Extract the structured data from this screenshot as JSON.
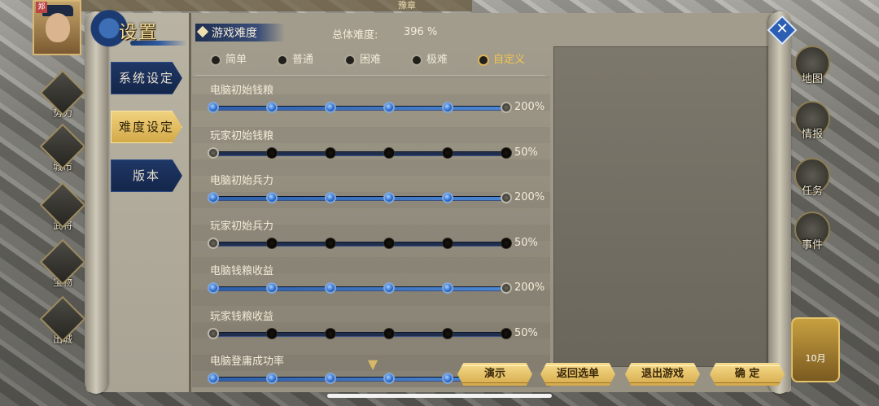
{
  "background": {
    "top_label": "豫章",
    "portrait_tag": "郑",
    "left_menu": [
      {
        "label": "势力"
      },
      {
        "label": "城市"
      },
      {
        "label": "武将"
      },
      {
        "label": "宝物"
      },
      {
        "label": "出城"
      }
    ],
    "right_menu": [
      {
        "label": "地图"
      },
      {
        "label": "情报"
      },
      {
        "label": "任务"
      },
      {
        "label": "事件"
      }
    ],
    "month": "10月"
  },
  "panel": {
    "title": "设置",
    "close_glyph": "✕",
    "tabs": [
      {
        "label": "系统设定",
        "active": false
      },
      {
        "label": "难度设定",
        "active": true
      },
      {
        "label": "版本",
        "active": false
      }
    ]
  },
  "difficulty": {
    "section_title": "游戏难度",
    "overall_label": "总体难度:",
    "overall_value": "396 %",
    "options": [
      {
        "label": "简单",
        "selected": false
      },
      {
        "label": "普通",
        "selected": false
      },
      {
        "label": "困难",
        "selected": false
      },
      {
        "label": "极难",
        "selected": false
      },
      {
        "label": "自定义",
        "selected": true
      }
    ],
    "sliders": [
      {
        "label": "电脑初始钱粮",
        "value": "200%",
        "level": 5
      },
      {
        "label": "玩家初始钱粮",
        "value": "50%",
        "level": 0
      },
      {
        "label": "电脑初始兵力",
        "value": "200%",
        "level": 5
      },
      {
        "label": "玩家初始兵力",
        "value": "50%",
        "level": 0
      },
      {
        "label": "电脑钱粮收益",
        "value": "200%",
        "level": 5
      },
      {
        "label": "玩家钱粮收益",
        "value": "50%",
        "level": 0
      },
      {
        "label": "电脑登庸成功率",
        "value": "",
        "level": 5
      }
    ]
  },
  "buttons": {
    "demo": "演示",
    "back_to_menu": "返回选单",
    "exit_game": "退出游戏",
    "confirm": "确 定"
  },
  "colors": {
    "accent_gold": "#f4c64e",
    "tab_blue": "#1f3766",
    "slider_blue": "#2f6fcf"
  }
}
